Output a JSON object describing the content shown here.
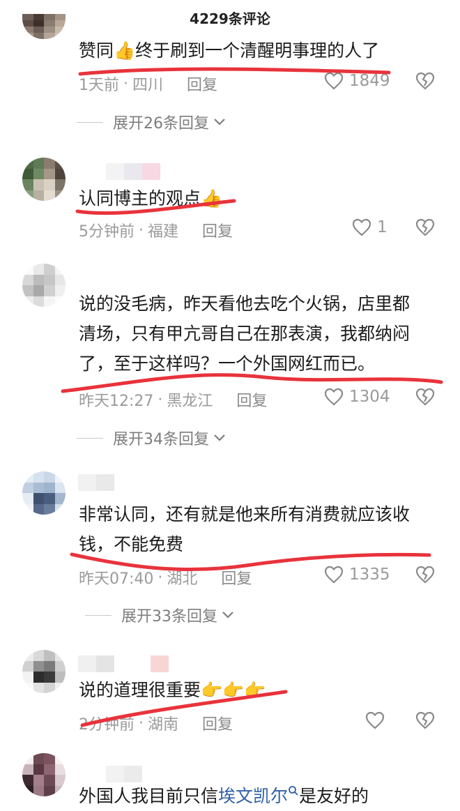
{
  "header": {
    "title": "4229条评论"
  },
  "comments": [
    {
      "text_lines": [
        "赞同👍终于刷到一个清醒明事理的人了"
      ],
      "time": "1天前",
      "location": "四川",
      "reply": "回复",
      "likes": "1849",
      "expand": "展开26条回复"
    },
    {
      "text_lines": [
        "认同博主的观点👍"
      ],
      "time": "5分钟前",
      "location": "福建",
      "reply": "回复",
      "likes": "1"
    },
    {
      "text_lines": [
        "说的没毛病，昨天看他去吃个火锅，店里都",
        "清场，只有甲亢哥自己在那表演，我都纳闷",
        "了，至于这样吗？一个外国网红而已。"
      ],
      "time": "昨天12:27",
      "location": "黑龙江",
      "reply": "回复",
      "likes": "1304",
      "expand": "展开34条回复"
    },
    {
      "text_lines": [
        "非常认同，还有就是他来所有消费就应该收",
        "钱，不能免费"
      ],
      "time": "昨天07:40",
      "location": "湖北",
      "reply": "回复",
      "likes": "1335",
      "expand": "展开33条回复"
    },
    {
      "text_lines": [
        "说的道理很重要👉👉👉"
      ],
      "time": "2分钟前",
      "location": "湖南",
      "reply": "回复",
      "likes": ""
    },
    {
      "text_prefix": "外国人我目前只信",
      "text_link": "埃文凯尔",
      "text_suffix": "是友好的"
    }
  ],
  "colors": {
    "underline": "#e8333c",
    "link": "#2f5fa8",
    "meta": "#9a9a9a"
  },
  "icons": {
    "like": "heart-outline-icon",
    "dislike": "broken-heart-icon",
    "expand": "chevron-down-icon",
    "search": "search-icon"
  }
}
